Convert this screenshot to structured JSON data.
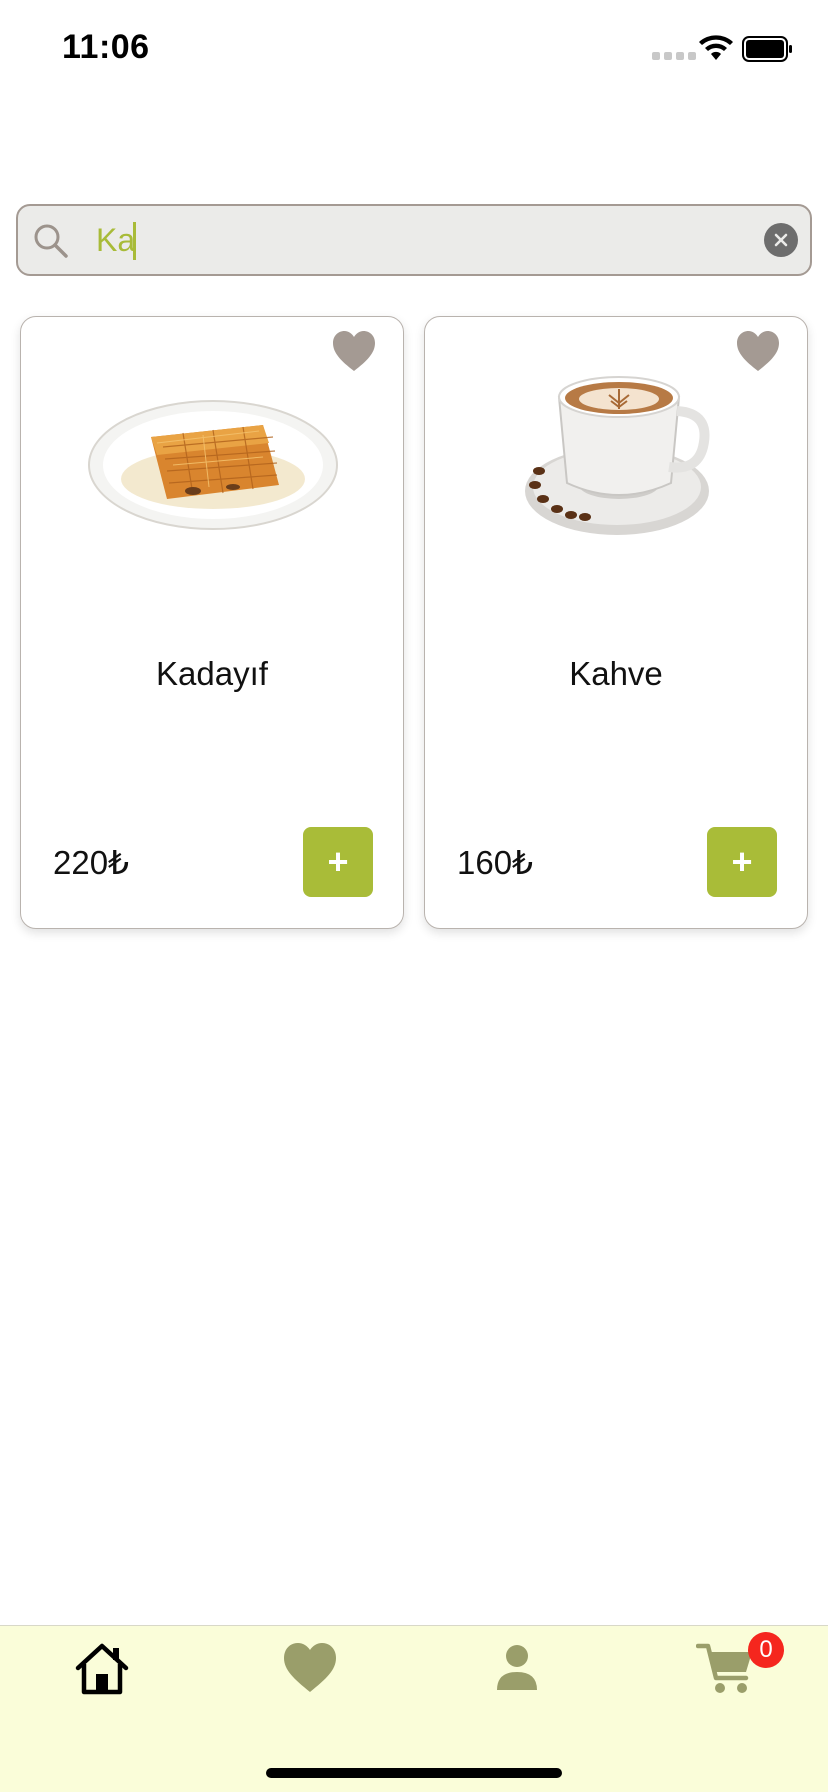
{
  "status_bar": {
    "time": "11:06"
  },
  "search": {
    "value": "Ka",
    "placeholder": ""
  },
  "products": [
    {
      "name": "Kadayıf",
      "price": "220₺",
      "add_label": "+",
      "image": "kadayif-dessert-image",
      "favorite_icon": "heart-icon"
    },
    {
      "name": "Kahve",
      "price": "160₺",
      "add_label": "+",
      "image": "coffee-cup-image",
      "favorite_icon": "heart-icon"
    }
  ],
  "tab_bar": {
    "items": [
      {
        "icon": "home-icon",
        "active": true
      },
      {
        "icon": "heart-icon",
        "active": false
      },
      {
        "icon": "user-icon",
        "active": false
      },
      {
        "icon": "cart-icon",
        "active": false
      }
    ],
    "cart_count": "0"
  },
  "colors": {
    "accent": "#a9bc38",
    "heart": "#a49a93",
    "tab_bar_bg": "#fafdd9",
    "tab_icon": "#9a9e6a",
    "badge": "#f5261e"
  }
}
